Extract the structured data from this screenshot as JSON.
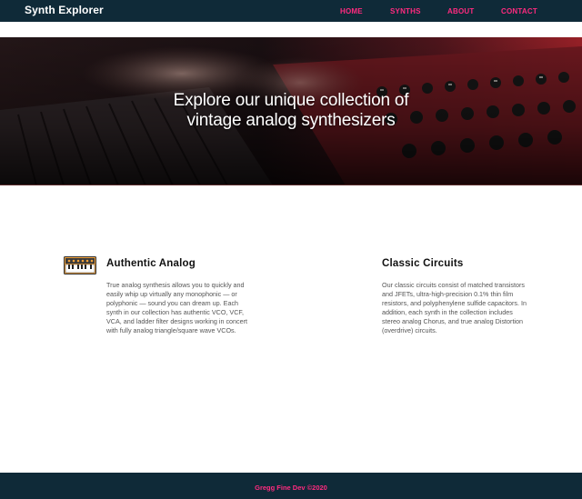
{
  "navbar": {
    "brand": "Synth Explorer",
    "links": [
      {
        "label": "HOME"
      },
      {
        "label": "SYNTHS"
      },
      {
        "label": "ABOUT"
      },
      {
        "label": "CONTACT"
      }
    ],
    "link_color": "#ff2a7f",
    "bg_color": "#0f2a38"
  },
  "hero": {
    "line1": "Explore our unique collection of",
    "line2": "vintage analog synthesizers",
    "image": "hands-playing-synthesizer-photo"
  },
  "features": [
    {
      "icon": "synth-keyboard-icon",
      "title": "Authentic Analog",
      "body": "True analog synthesis allows you to quickly and easily whip up virtually any monophonic — or polyphonic — sound you can dream up. Each synth in our collection has authentic VCO, VCF, VCA, and ladder filter designs working in concert with fully analog triangle/square wave VCOs."
    },
    {
      "icon": "sound-wave-icon",
      "title": "Classic Circuits",
      "body": "Our classic circuits consist of matched transistors and JFETs, ultra-high-precision 0.1% thin film resistors, and polyphenylene sulfide capacitors. In addition, each synth in the collection includes stereo analog Chorus, and true analog Distortion (overdrive) circuits."
    }
  ],
  "footer": {
    "text": "Gregg Fine Dev ©2020"
  }
}
